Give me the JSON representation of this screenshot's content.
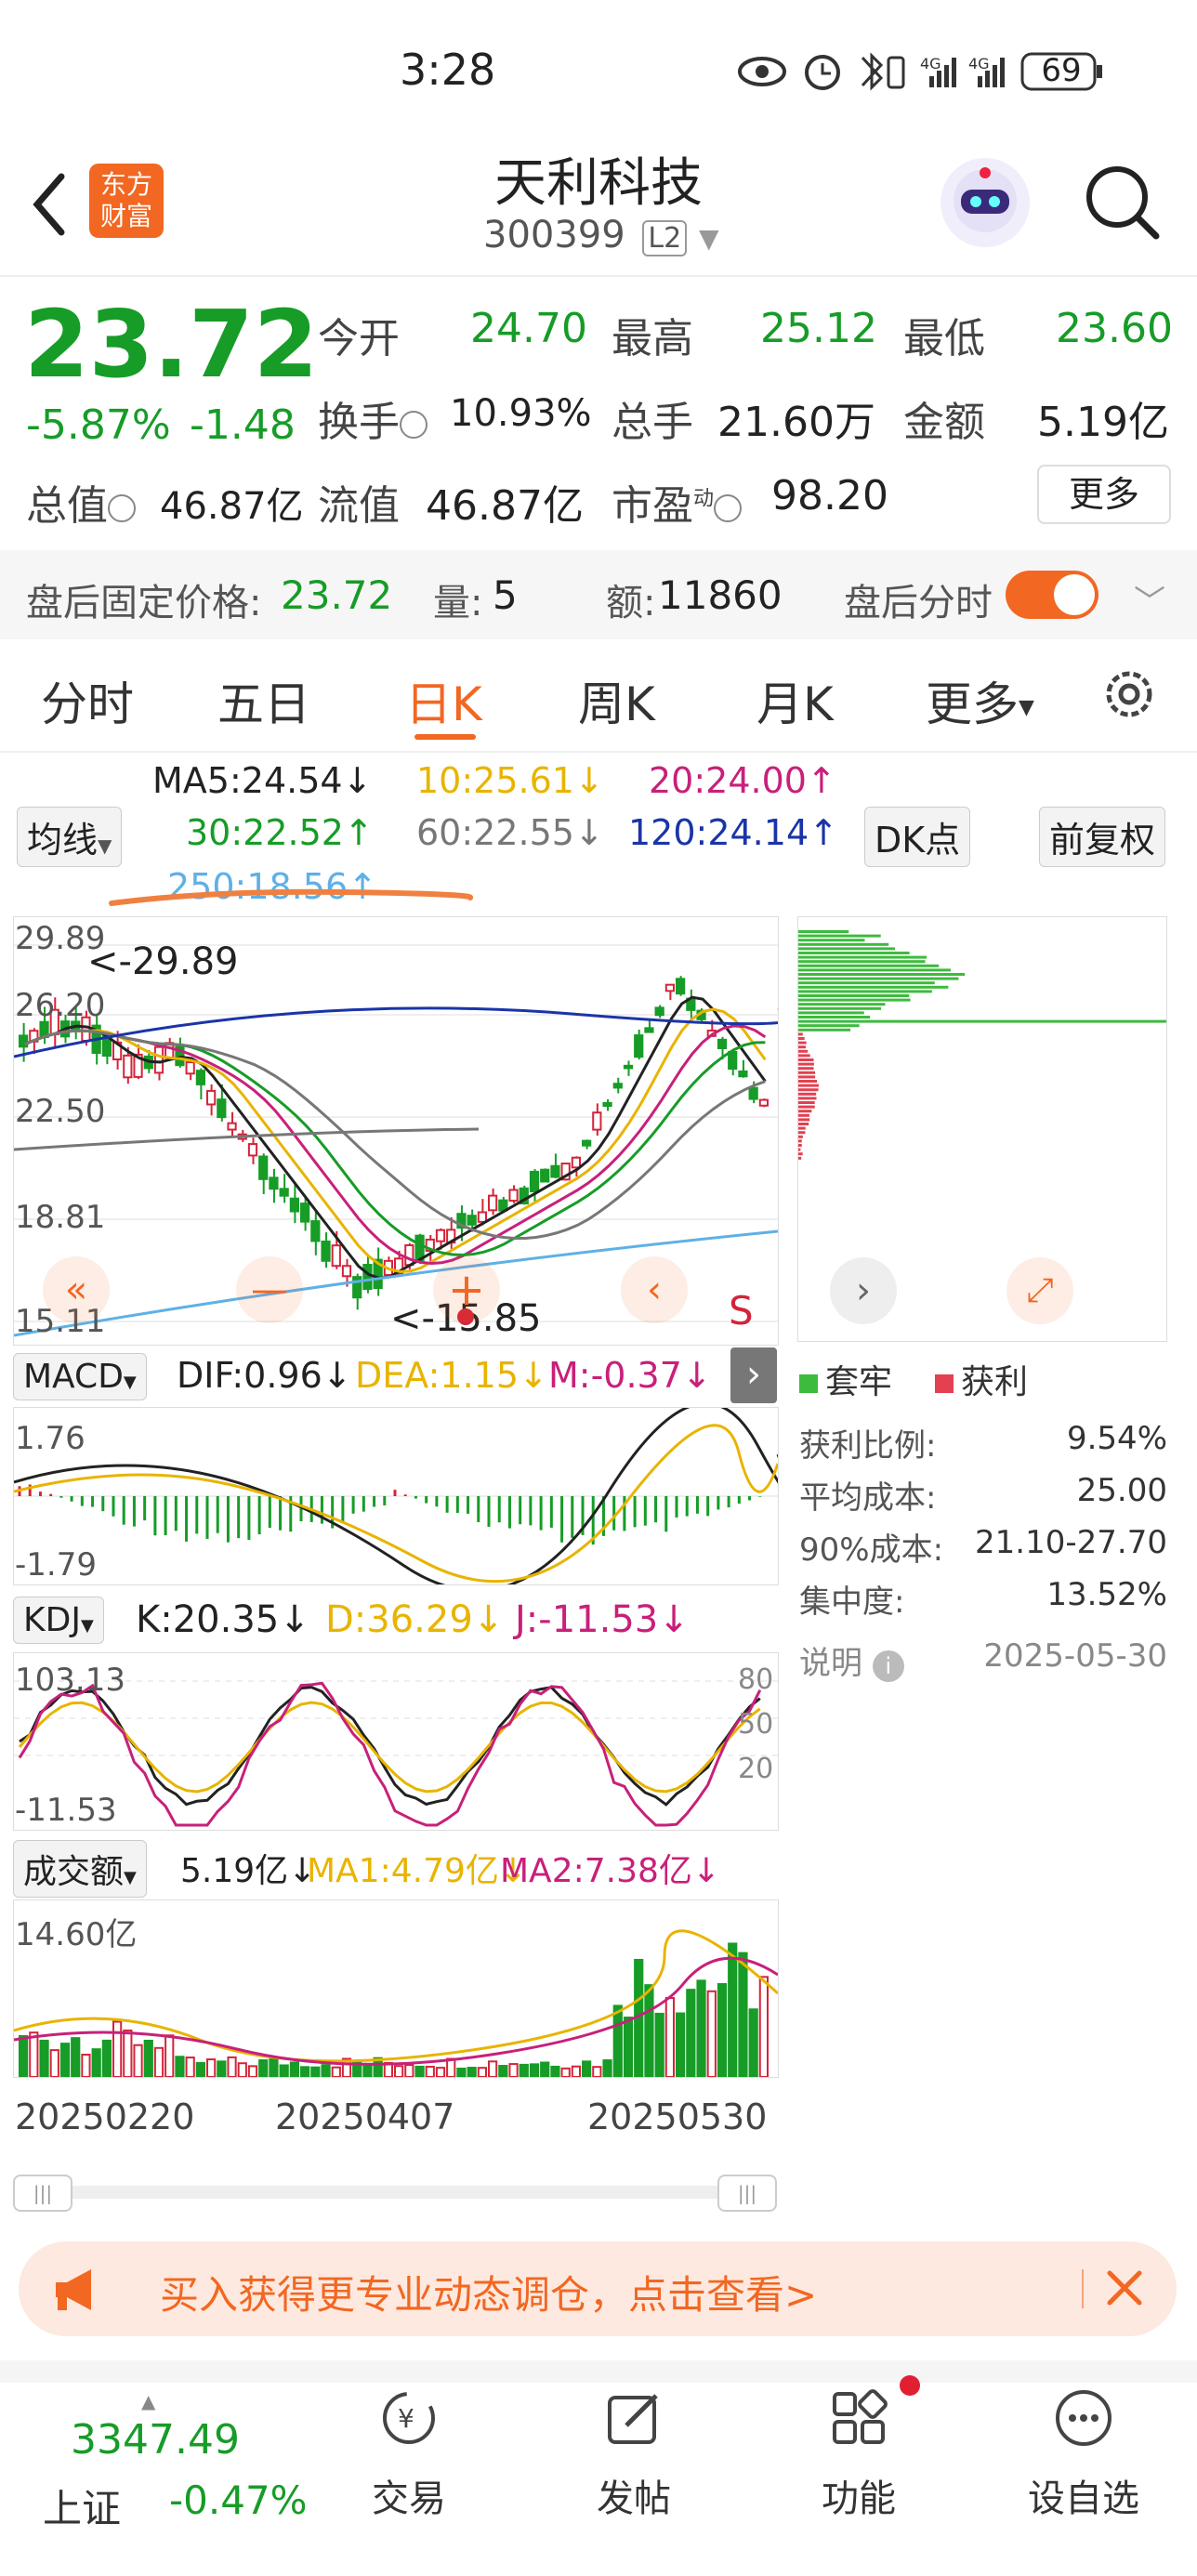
{
  "status_bar": {
    "time": "3:28",
    "battery": "69"
  },
  "header": {
    "logo_text": "东方\n财富",
    "stock_name": "天利科技",
    "stock_code": "300399",
    "level": "L2"
  },
  "quote": {
    "price": "23.72",
    "change_pct": "-5.87%",
    "change": "-1.48",
    "open_label": "今开",
    "open": "24.70",
    "high_label": "最高",
    "high": "25.12",
    "low_label": "最低",
    "low": "23.60",
    "turnover_label": "换手",
    "turnover": "10.93%",
    "volume_label": "总手",
    "volume": "21.60万",
    "amount_label": "金额",
    "amount": "5.19亿",
    "mktcap_label": "总值",
    "mktcap": "46.87亿",
    "float_label": "流值",
    "float": "46.87亿",
    "pe_label": "市盈",
    "pe_sup": "动",
    "pe": "98.20",
    "more": "更多"
  },
  "after_hours": {
    "price_label": "盘后固定价格:",
    "price": "23.72",
    "vol_label": "量:",
    "vol": "5",
    "amt_label": "额:",
    "amt": "11860",
    "toggle_label": "盘后分时"
  },
  "tabs": [
    "分时",
    "五日",
    "日K",
    "周K",
    "月K",
    "更多"
  ],
  "ma": {
    "button": "均线",
    "ma5": "MA5:24.54↓",
    "ma10": "10:25.61↓",
    "ma20": "20:24.00↑",
    "ma30": "30:22.52↑",
    "ma60": "60:22.55↓",
    "ma120": "120:24.14↑",
    "ma250": "250:18.56↑",
    "dk_button": "DK点",
    "fq_button": "前复权",
    "colors": {
      "ma5": "#222222",
      "ma10": "#e8b400",
      "ma20": "#c8207a",
      "ma30": "#169c27",
      "ma60": "#777777",
      "ma120": "#1a34a8",
      "ma250": "#5fb0e6"
    }
  },
  "kchart": {
    "y_labels": [
      "29.89",
      "26.20",
      "22.50",
      "18.81",
      "15.11"
    ],
    "high_mark": "<-29.89",
    "low_mark": "<-15.85",
    "s_marker": "S"
  },
  "chip": {
    "legend_trap": "套牢",
    "legend_profit": "获利",
    "rows": [
      {
        "label": "获利比例:",
        "value": "9.54%"
      },
      {
        "label": "平均成本:",
        "value": "25.00"
      },
      {
        "label": "90%成本:",
        "value": "21.10-27.70"
      },
      {
        "label": "集中度:",
        "value": "13.52%"
      }
    ],
    "note": "说明",
    "date": "2025-05-30"
  },
  "macd": {
    "button": "MACD",
    "dif": "DIF:0.96↓",
    "dea": "DEA:1.15↓",
    "m": "M:-0.37↓",
    "top": "1.76",
    "bottom": "-1.79"
  },
  "kdj": {
    "button": "KDJ",
    "k": "K:20.35↓",
    "d": "D:36.29↓",
    "j": "J:-11.53↓",
    "top": "103.13",
    "bottom": "-11.53",
    "r80": "80",
    "r50": "50",
    "r20": "20"
  },
  "volume": {
    "button": "成交额",
    "value": "5.19亿↓",
    "ma1": "MA1:4.79亿↓",
    "ma2": "MA2:7.38亿↓",
    "top": "14.60亿"
  },
  "dates": [
    "20250220",
    "20250407",
    "20250530"
  ],
  "banner": {
    "text": "买入获得更专业动态调仓，点击查看>"
  },
  "bottom_nav": {
    "index_value": "3347.49",
    "index_name": "上证",
    "index_change": "-0.47%",
    "items": [
      "交易",
      "发帖",
      "功能",
      "设自选"
    ]
  }
}
